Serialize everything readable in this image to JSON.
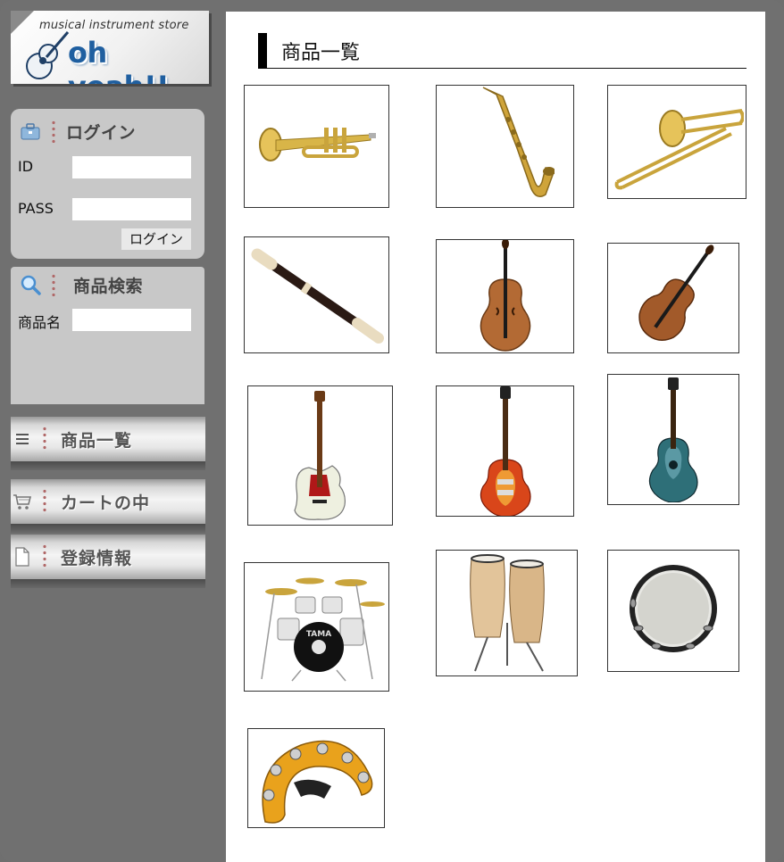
{
  "logo": {
    "tagline": "musical instrument store",
    "brand": "oh yeah!!"
  },
  "login": {
    "title": "ログイン",
    "id_label": "ID",
    "pass_label": "PASS",
    "id_value": "",
    "pass_value": "",
    "button_label": "ログイン"
  },
  "search": {
    "title": "商品検索",
    "name_label": "商品名",
    "name_value": ""
  },
  "nav": {
    "items": [
      {
        "label": "商品一覧",
        "icon": "list-icon"
      },
      {
        "label": "カートの中",
        "icon": "cart-icon"
      },
      {
        "label": "登録情報",
        "icon": "document-icon"
      }
    ]
  },
  "main": {
    "title": "商品一覧"
  },
  "products": [
    {
      "icon": "trumpet"
    },
    {
      "icon": "saxophone"
    },
    {
      "icon": "trombone"
    },
    {
      "icon": "recorder"
    },
    {
      "icon": "contrabass"
    },
    {
      "icon": "violin"
    },
    {
      "icon": "electric-bass"
    },
    {
      "icon": "electric-guitar"
    },
    {
      "icon": "acoustic-guitar"
    },
    {
      "icon": "drum-kit",
      "logo_text": "TAMA"
    },
    {
      "icon": "conga"
    },
    {
      "icon": "tambourine"
    },
    {
      "icon": "hand-tambourine"
    }
  ],
  "colors": {
    "background": "#707070",
    "panel": "#c8c8c8",
    "brand_blue": "#1f5fa0",
    "brass": "#c9a43c",
    "wood": "#a25a2a"
  }
}
